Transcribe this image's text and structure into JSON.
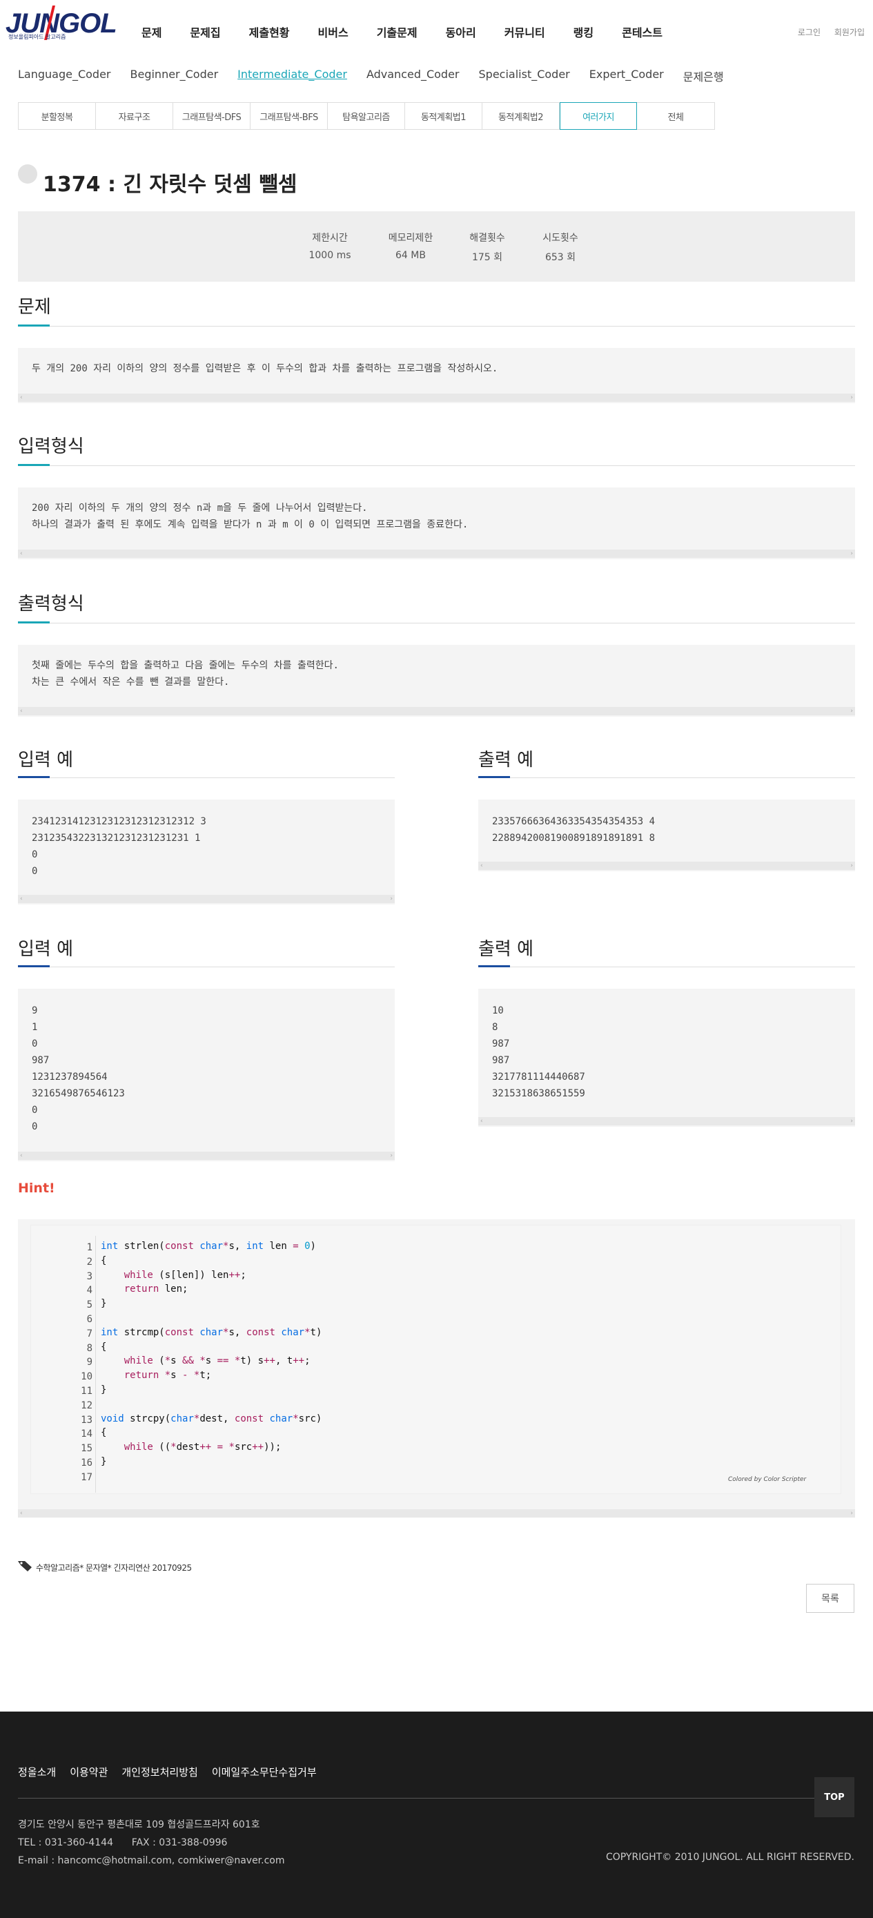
{
  "header": {
    "logo_text": "JUNGOL",
    "logo_sub": "정보올림피아드 알고리즘",
    "nav": [
      "문제",
      "문제집",
      "제출현황",
      "비버스",
      "기출문제",
      "동아리",
      "커뮤니티",
      "랭킹",
      "콘테스트"
    ],
    "util": [
      "로그인",
      "회원가입"
    ]
  },
  "levels": [
    "Language_Coder",
    "Beginner_Coder",
    "Intermediate_Coder",
    "Advanced_Coder",
    "Specialist_Coder",
    "Expert_Coder",
    "문제은행"
  ],
  "levels_active": "Intermediate_Coder",
  "categories": [
    "분할정복",
    "자료구조",
    "그래프탐색-DFS",
    "그래프탐색-BFS",
    "탐욕알고리즘",
    "동적계획법1",
    "동적계획법2",
    "여러가지",
    "전체"
  ],
  "categories_active": "여러가지",
  "problem": {
    "title": "1374 : 긴 자릿수 덧셈 뺄셈",
    "stats": [
      {
        "label": "제한시간",
        "value": "1000 ms"
      },
      {
        "label": "메모리제한",
        "value": "64 MB"
      },
      {
        "label": "해결횟수",
        "value": "175 회"
      },
      {
        "label": "시도횟수",
        "value": "653 회"
      }
    ]
  },
  "sections": {
    "desc_title": "문제",
    "desc_text": "두 개의 200 자리 이하의 양의 정수를 입력받은 후 이 두수의 합과 차를 출력하는 프로그램을 작성하시오.",
    "input_title": "입력형식",
    "input_text": "200 자리 이하의 두 개의 양의 정수 n과 m을 두 줄에 나누어서 입력받는다.\n하나의 결과가 출력 된 후에도 계속 입력을 받다가 n 과 m 이 0 이 입력되면 프로그램을 종료한다.",
    "output_title": "출력형식",
    "output_text": "첫째 줄에는 두수의 합을 출력하고 다음 줄에는 두수의 차를 출력한다.\n차는 큰 수에서 작은 수를 뺀 결과를 말한다."
  },
  "examples": [
    {
      "in_title": "입력 예",
      "in_text": "2341231412312312312312312312 3\n231235432231321231231231231 1\n0\n0",
      "out_title": "출력 예",
      "out_text": "23357666364363354354354353 4\n22889420081900891891891891 8"
    },
    {
      "in_title": "입력 예",
      "in_text": "9\n1\n0\n987\n1231237894564\n3216549876546123\n0\n0",
      "out_title": "출력 예",
      "out_text": "10\n8\n987\n987\n3217781114440687\n3215318638651559"
    }
  ],
  "hint": {
    "title": "Hint!",
    "line_numbers": "1\n2\n3\n4\n5\n6\n7\n8\n9\n10\n11\n12\n13\n14\n15\n16\n17",
    "credit": "Colored by Color Scripter"
  },
  "tagline": "수학알고리즘* 문자열* 긴자리연산 20170925",
  "list_button": "목록",
  "footer": {
    "links": [
      "정올소개",
      "이용약관",
      "개인정보처리방침",
      "이메일주소무단수집거부"
    ],
    "address": "경기도 안양시 동안구 평촌대로 109 협성골드프라자 601호",
    "phone": "TEL : 031-360-4144      FAX : 031-388-0996",
    "email": "E-mail : hancomc@hotmail.com, comkiwer@naver.com",
    "copyright": "COPYRIGHT© 2010 JUNGOL. ALL RIGHT RESERVED.",
    "top": "TOP"
  },
  "colors": {
    "accent": "#1aa6b7",
    "hint": "#e74c3c",
    "footer_bg": "#1c1c1c"
  }
}
